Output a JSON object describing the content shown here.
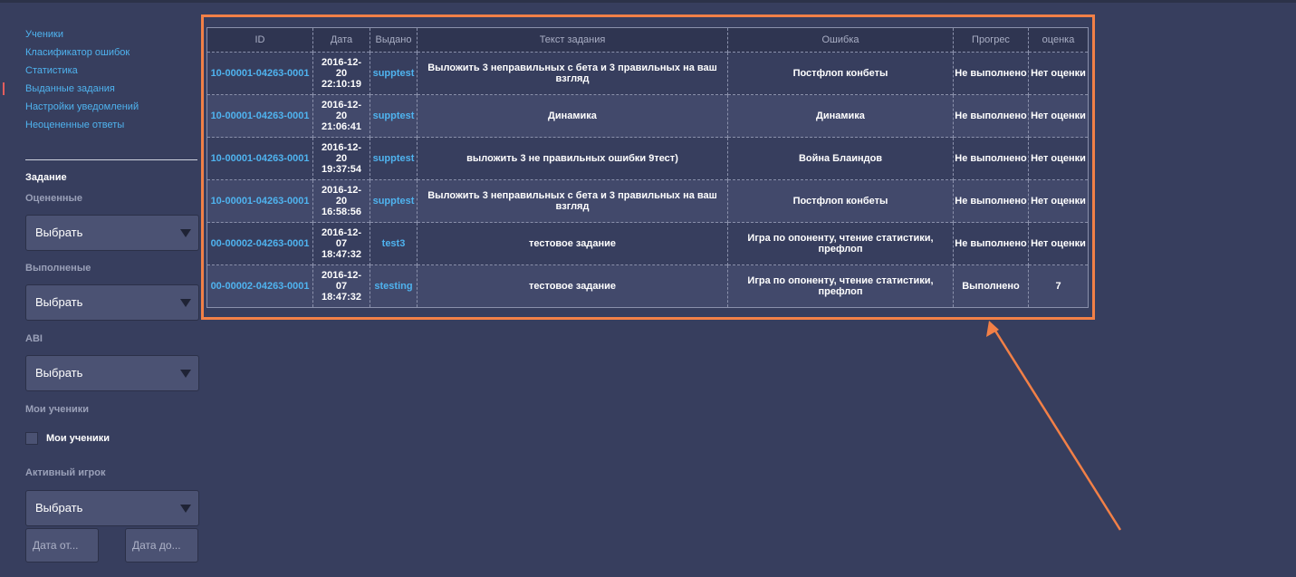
{
  "sidebar": {
    "nav": [
      "Ученики",
      "Класификатор ошибок",
      "Статистика",
      "Выданные задания",
      "Настройки уведомлений",
      "Неоцененные ответы"
    ],
    "active_index": 3,
    "section_title": "Задание",
    "filters": {
      "rated_label": "Оцененные",
      "rated_value": "Выбрать",
      "completed_label": "Выполненые",
      "completed_value": "Выбрать",
      "abi_label": "ABI",
      "abi_value": "Выбрать",
      "my_students_label": "Мои ученики",
      "my_students_checkbox_label": "Мои ученики",
      "active_player_label": "Активный игрок",
      "active_player_value": "Выбрать",
      "date_from_placeholder": "Дата от...",
      "date_to_placeholder": "Дата до..."
    }
  },
  "table": {
    "headers": [
      "ID",
      "Дата",
      "Выдано",
      "Текст задания",
      "Ошибка",
      "Прогрес",
      "оценка"
    ],
    "rows": [
      {
        "id": "10-00001-04263-0001",
        "date": "2016-12-\n20\n22:10:19",
        "issued": "supptest",
        "text": "Выложить 3 неправильных с бета и 3 правильных на ваш взгляд",
        "error": "Постфлоп конбеты",
        "progress": "Не выполнено",
        "grade": "Нет оценки"
      },
      {
        "id": "10-00001-04263-0001",
        "date": "2016-12-\n20\n21:06:41",
        "issued": "supptest",
        "text": "Динамика",
        "error": "Динамика",
        "progress": "Не выполнено",
        "grade": "Нет оценки"
      },
      {
        "id": "10-00001-04263-0001",
        "date": "2016-12-\n20\n19:37:54",
        "issued": "supptest",
        "text": "выложить 3 не правильных ошибки 9тест)",
        "error": "Война Блаиндов",
        "progress": "Не выполнено",
        "grade": "Нет оценки"
      },
      {
        "id": "10-00001-04263-0001",
        "date": "2016-12-\n20\n16:58:56",
        "issued": "supptest",
        "text": "Выложить 3 неправильных с бета и 3 правильных на ваш взгляд",
        "error": "Постфлоп конбеты",
        "progress": "Не выполнено",
        "grade": "Нет оценки"
      },
      {
        "id": "00-00002-04263-0001",
        "date": "2016-12-\n07\n18:47:32",
        "issued": "test3",
        "text": "тестовое задание",
        "error": "Игра по опоненту, чтение статистики, префлоп",
        "progress": "Не выполнено",
        "grade": "Нет оценки"
      },
      {
        "id": "00-00002-04263-0001",
        "date": "2016-12-\n07\n18:47:32",
        "issued": "stesting",
        "text": "тестовое задание",
        "error": "Игра по опоненту, чтение статистики, префлоп",
        "progress": "Выполнено",
        "grade": "7"
      }
    ]
  },
  "colors": {
    "background": "#373e5e",
    "link": "#4fb3ef",
    "annotation": "#f28047"
  }
}
